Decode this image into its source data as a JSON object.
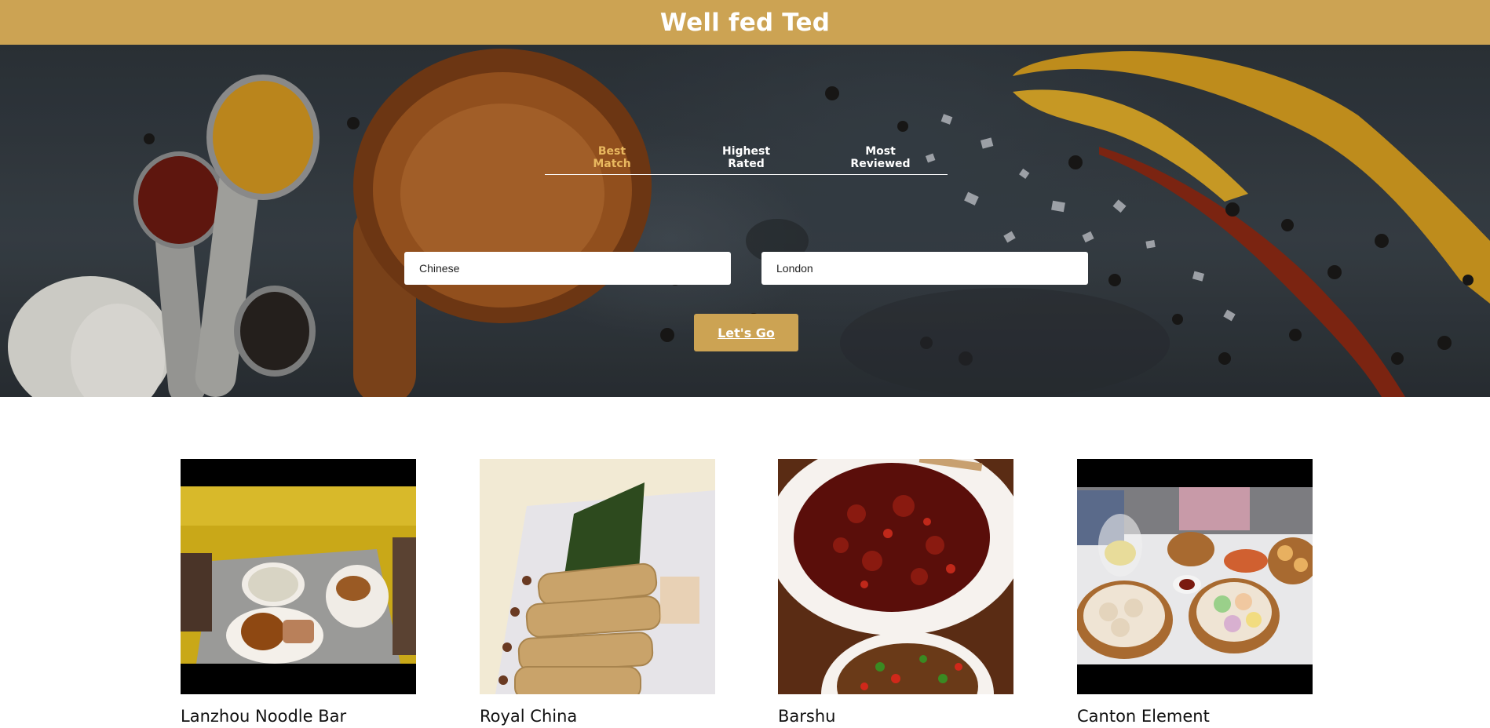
{
  "header": {
    "title": "Well fed Ted"
  },
  "sort_tabs": [
    {
      "line1": "Best",
      "line2": "Match",
      "active": true
    },
    {
      "line1": "Highest",
      "line2": "Rated",
      "active": false
    },
    {
      "line1": "Most",
      "line2": "Reviewed",
      "active": false
    }
  ],
  "search": {
    "term_value": "Chinese",
    "location_value": "London",
    "submit_label": "Let's Go"
  },
  "businesses": [
    {
      "name": "Lanzhou Noodle Bar"
    },
    {
      "name": "Royal China"
    },
    {
      "name": "Barshu"
    },
    {
      "name": "Canton Element"
    }
  ],
  "colors": {
    "brand": "#cca353",
    "active_tab": "#e9b85f",
    "hero_background": "#353d44"
  }
}
